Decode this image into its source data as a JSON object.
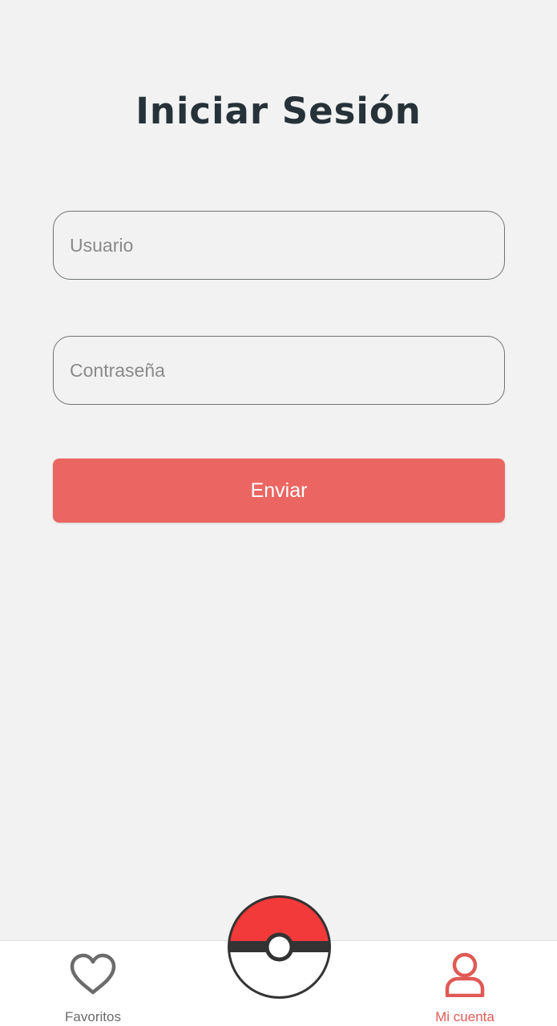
{
  "page": {
    "title": "Iniciar Sesión"
  },
  "form": {
    "username_placeholder": "Usuario",
    "username_value": "",
    "password_placeholder": "Contraseña",
    "password_value": "",
    "submit_label": "Enviar"
  },
  "bottom_nav": {
    "items": [
      {
        "label": "Favoritos",
        "icon": "heart-icon",
        "active": false
      },
      {
        "label": "Mi cuenta",
        "icon": "user-icon",
        "active": true
      }
    ],
    "center_button": {
      "icon": "pokeball-icon"
    }
  },
  "colors": {
    "background": "#f2f2f2",
    "title": "#263238",
    "accent": "#eb6662",
    "active_nav": "#e05a55",
    "inactive_nav": "#6b6b6b",
    "pokeball_red": "#f23a3a"
  }
}
